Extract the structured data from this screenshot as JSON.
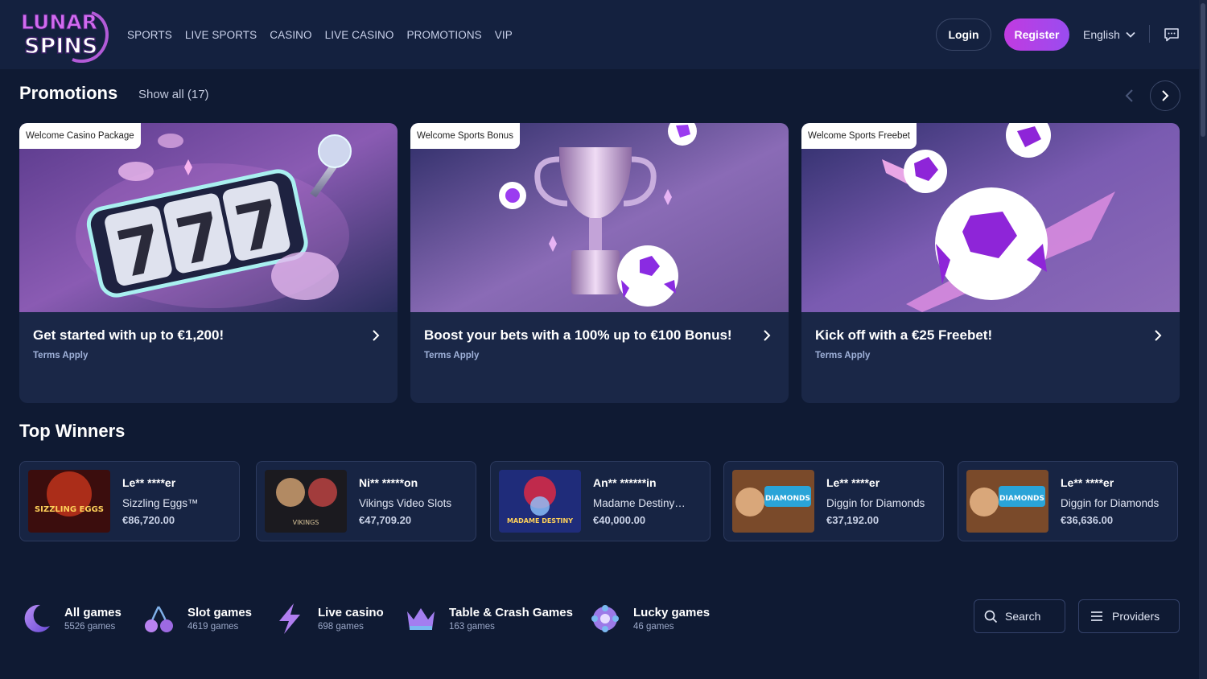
{
  "brand": {
    "line1": "LUNAR",
    "line2": "SPINS"
  },
  "nav": {
    "items": [
      "SPORTS",
      "LIVE SPORTS",
      "CASINO",
      "LIVE CASINO",
      "PROMOTIONS",
      "VIP"
    ]
  },
  "header": {
    "login_label": "Login",
    "register_label": "Register",
    "language": "English"
  },
  "promotions": {
    "title": "Promotions",
    "show_all": "Show all (17)",
    "cards": [
      {
        "tag": "Welcome Casino Package",
        "title": "Get started with up to €1,200!",
        "terms": "Terms Apply"
      },
      {
        "tag": "Welcome Sports Bonus",
        "title": "Boost your bets with a 100% up to €100 Bonus!",
        "terms": "Terms Apply"
      },
      {
        "tag": "Welcome Sports Freebet",
        "title": "Kick off with a €25 Freebet!",
        "terms": "Terms Apply"
      }
    ]
  },
  "top_winners": {
    "title": "Top Winners",
    "items": [
      {
        "name": "Le** ****er",
        "game": "Sizzling Eggs™",
        "amount": "€86,720.00",
        "thumb_text": "SIZZLING EGGS"
      },
      {
        "name": "Ni** *****on",
        "game": "Vikings Video Slots",
        "amount": "€47,709.20",
        "thumb_text": "VIKINGS"
      },
      {
        "name": "An** ******in",
        "game": "Madame Destiny…",
        "amount": "€40,000.00",
        "thumb_text": "MADAME DESTINY"
      },
      {
        "name": "Le** ****er",
        "game": "Diggin for Diamonds",
        "amount": "€37,192.00",
        "thumb_text": "DIAMONDS"
      },
      {
        "name": "Le** ****er",
        "game": "Diggin for Diamonds",
        "amount": "€36,636.00",
        "thumb_text": "DIAMONDS"
      }
    ]
  },
  "categories": [
    {
      "name": "All games",
      "count": "5526 games",
      "icon": "moon-icon"
    },
    {
      "name": "Slot games",
      "count": "4619 games",
      "icon": "cherries-icon"
    },
    {
      "name": "Live casino",
      "count": "698 games",
      "icon": "lightning-icon"
    },
    {
      "name": "Table & Crash Games",
      "count": "163 games",
      "icon": "crown-icon"
    },
    {
      "name": "Lucky games",
      "count": "46 games",
      "icon": "lucky-wheel-icon"
    }
  ],
  "tools": {
    "search_label": "Search",
    "providers_label": "Providers"
  },
  "colors": {
    "bg": "#0f1a33",
    "header": "#14213f",
    "card": "#1a2747",
    "accent": "#c13be0"
  }
}
